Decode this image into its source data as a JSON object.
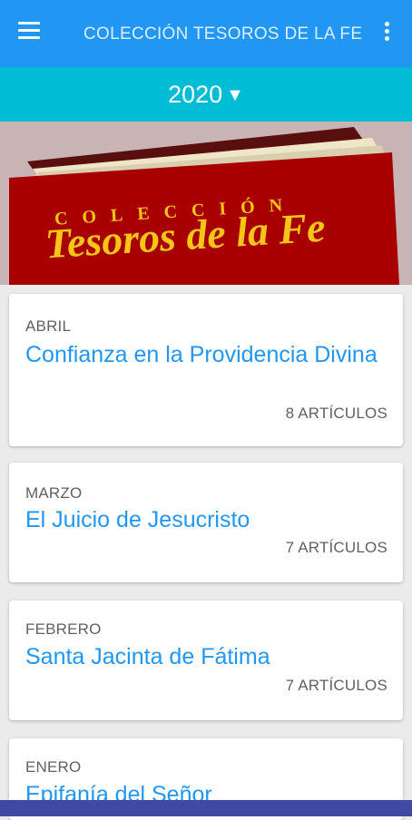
{
  "appbar": {
    "title": "COLECCIÓN TESOROS DE LA FE",
    "menu_icon": "hamburger-menu-icon",
    "more_icon": "more-vertical-icon",
    "color": "#2196f3"
  },
  "year_selector": {
    "value": "2020",
    "caret": "▼",
    "color": "#00bcd4"
  },
  "banner": {
    "line1": "COLECCIÓN",
    "line2": "Tesoros de la Fe",
    "book_color": "#a80000",
    "text_color": "#f5c518"
  },
  "issues": [
    {
      "month": "ABRIL",
      "title": "Confianza en la Providencia Divina",
      "count": "8 ARTÍCULOS"
    },
    {
      "month": "MARZO",
      "title": "El Juicio de Jesucristo",
      "count": "7 ARTÍCULOS"
    },
    {
      "month": "FEBRERO",
      "title": "Santa Jacinta de Fátima",
      "count": "7 ARTÍCULOS"
    },
    {
      "month": "ENERO",
      "title": "Epifanía del Señor"
    }
  ]
}
